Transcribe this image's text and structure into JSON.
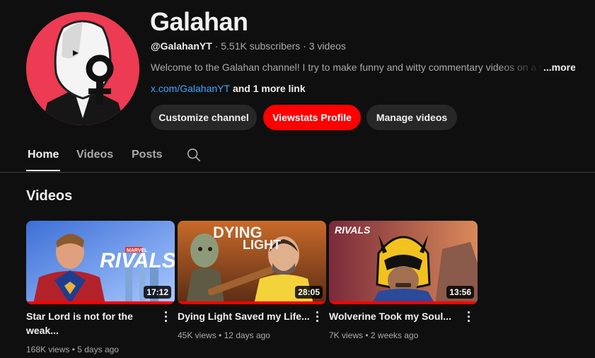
{
  "channel": {
    "name": "Galahan",
    "handle": "@GalahanYT",
    "subscribers": "5.51K subscribers",
    "videos_count": "3 videos",
    "separator": " · ",
    "description": "Welcome to the Galahan channel! I try to make funny and witty commentary videos on a v",
    "more_label": "...more",
    "link": "x.com/GalahanYT",
    "more_links": " and 1 more link"
  },
  "buttons": {
    "customize": "Customize channel",
    "viewstats": "Viewstats Profile",
    "manage": "Manage videos"
  },
  "tabs": [
    "Home",
    "Videos",
    "Posts"
  ],
  "section": {
    "title": "Videos"
  },
  "videos": [
    {
      "title_line1": "Star Lord is not for the",
      "title_line2": "weak...",
      "duration": "17:12",
      "views": "168K views",
      "age": "5 days ago",
      "thumb_text": "RIVALS",
      "thumb_subtext": "MARVEL"
    },
    {
      "title_line1": "Dying Light Saved my Life...",
      "title_line2": "",
      "duration": "28:05",
      "views": "45K views",
      "age": "12 days ago",
      "thumb_text": "DYING",
      "thumb_subtext": "LIGHT"
    },
    {
      "title_line1": "Wolverine Took my Soul...",
      "title_line2": "",
      "duration": "13:56",
      "views": "7K views",
      "age": "2 weeks ago",
      "thumb_text": "RIVALS",
      "thumb_subtext": ""
    }
  ],
  "meta_separator": " • ",
  "icons": {
    "search": "search-icon",
    "more_actions": "three-dots-vertical-icon"
  },
  "colors": {
    "background": "#0f0f0f",
    "accent_red": "#ff0000",
    "link_blue": "#3ea6ff",
    "avatar_bg": "#ec3b52"
  }
}
